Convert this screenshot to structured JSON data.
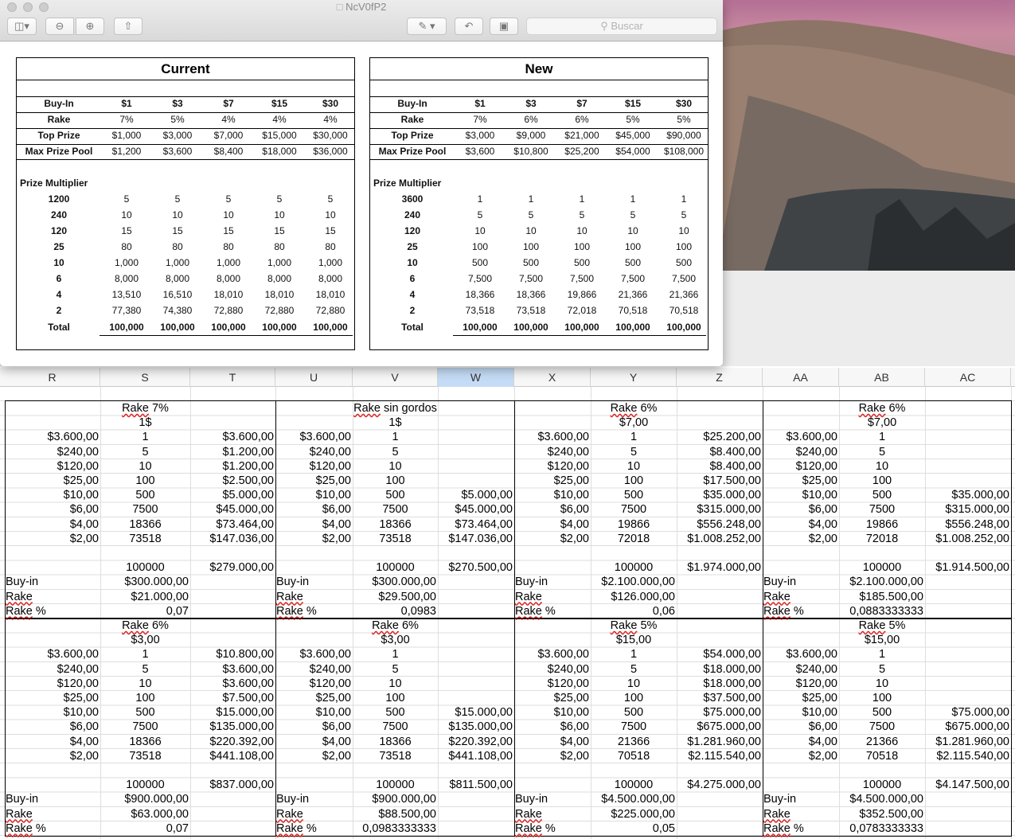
{
  "window": {
    "title": "NcV0fP2",
    "search_placeholder": "Buscar",
    "toolbar_icons": [
      "sidebar-icon",
      "zoom-out-icon",
      "zoom-in-icon",
      "share-icon",
      "markup-pen-icon",
      "rotate-icon",
      "toolbox-icon"
    ]
  },
  "preview": {
    "tables": [
      {
        "title": "Current",
        "columns": [
          "Buy-In",
          "$1",
          "$3",
          "$7",
          "$15",
          "$30"
        ],
        "rows": [
          [
            "Rake",
            "7%",
            "5%",
            "4%",
            "4%",
            "4%"
          ],
          [
            "Top Prize",
            "$1,000",
            "$3,000",
            "$7,000",
            "$15,000",
            "$30,000"
          ],
          [
            "Max Prize Pool",
            "$1,200",
            "$3,600",
            "$8,400",
            "$18,000",
            "$36,000"
          ]
        ],
        "multiplier_label": "Prize Multiplier",
        "multipliers": [
          [
            "1200",
            "5",
            "5",
            "5",
            "5",
            "5"
          ],
          [
            "240",
            "10",
            "10",
            "10",
            "10",
            "10"
          ],
          [
            "120",
            "15",
            "15",
            "15",
            "15",
            "15"
          ],
          [
            "25",
            "80",
            "80",
            "80",
            "80",
            "80"
          ],
          [
            "10",
            "1,000",
            "1,000",
            "1,000",
            "1,000",
            "1,000"
          ],
          [
            "6",
            "8,000",
            "8,000",
            "8,000",
            "8,000",
            "8,000"
          ],
          [
            "4",
            "13,510",
            "16,510",
            "18,010",
            "18,010",
            "18,010"
          ],
          [
            "2",
            "77,380",
            "74,380",
            "72,880",
            "72,880",
            "72,880"
          ]
        ],
        "total": [
          "Total",
          "100,000",
          "100,000",
          "100,000",
          "100,000",
          "100,000"
        ]
      },
      {
        "title": "New",
        "columns": [
          "Buy-In",
          "$1",
          "$3",
          "$7",
          "$15",
          "$30"
        ],
        "rows": [
          [
            "Rake",
            "7%",
            "6%",
            "6%",
            "5%",
            "5%"
          ],
          [
            "Top Prize",
            "$3,000",
            "$9,000",
            "$21,000",
            "$45,000",
            "$90,000"
          ],
          [
            "Max Prize Pool",
            "$3,600",
            "$10,800",
            "$25,200",
            "$54,000",
            "$108,000"
          ]
        ],
        "multiplier_label": "Prize Multiplier",
        "multipliers": [
          [
            "3600",
            "1",
            "1",
            "1",
            "1",
            "1"
          ],
          [
            "240",
            "5",
            "5",
            "5",
            "5",
            "5"
          ],
          [
            "120",
            "10",
            "10",
            "10",
            "10",
            "10"
          ],
          [
            "25",
            "100",
            "100",
            "100",
            "100",
            "100"
          ],
          [
            "10",
            "500",
            "500",
            "500",
            "500",
            "500"
          ],
          [
            "6",
            "7,500",
            "7,500",
            "7,500",
            "7,500",
            "7,500"
          ],
          [
            "4",
            "18,366",
            "18,366",
            "19,866",
            "21,366",
            "21,366"
          ],
          [
            "2",
            "73,518",
            "73,518",
            "72,018",
            "70,518",
            "70,518"
          ]
        ],
        "total": [
          "Total",
          "100,000",
          "100,000",
          "100,000",
          "100,000",
          "100,000"
        ]
      }
    ]
  },
  "sheet": {
    "columns": [
      "R",
      "S",
      "T",
      "U",
      "V",
      "W",
      "X",
      "Y",
      "Z",
      "AA",
      "AB",
      "AC"
    ],
    "selected_column": "W",
    "prize_values": [
      "$3.600,00",
      "$240,00",
      "$120,00",
      "$25,00",
      "$10,00",
      "$6,00",
      "$4,00",
      "$2,00"
    ],
    "label_buyin": "Buy-in",
    "label_rake": "Rake",
    "label_rakepct": "Rake %",
    "blocks": [
      {
        "title": "Rake 7%",
        "buyin": "1$",
        "counts": [
          "1",
          "5",
          "10",
          "100",
          "500",
          "7500",
          "18366",
          "73518"
        ],
        "payouts": [
          "$3.600,00",
          "$1.200,00",
          "$1.200,00",
          "$2.500,00",
          "$5.000,00",
          "$45.000,00",
          "$73.464,00",
          "$147.036,00"
        ],
        "total_count": "100000",
        "total_payout": "$279.000,00",
        "buyin_total": "$300.000,00",
        "rake": "$21.000,00",
        "rake_pct": "0,07"
      },
      {
        "title": "Rake sin gordos",
        "buyin": "1$",
        "counts": [
          "1",
          "5",
          "10",
          "100",
          "500",
          "7500",
          "18366",
          "73518"
        ],
        "payouts": [
          "",
          "",
          "",
          "",
          "$5.000,00",
          "$45.000,00",
          "$73.464,00",
          "$147.036,00"
        ],
        "total_count": "100000",
        "total_payout": "$270.500,00",
        "buyin_total": "$300.000,00",
        "rake": "$29.500,00",
        "rake_pct": "0,0983"
      },
      {
        "title": "Rake 6%",
        "buyin": "$7,00",
        "counts": [
          "1",
          "5",
          "10",
          "100",
          "500",
          "7500",
          "19866",
          "72018"
        ],
        "payouts": [
          "$25.200,00",
          "$8.400,00",
          "$8.400,00",
          "$17.500,00",
          "$35.000,00",
          "$315.000,00",
          "$556.248,00",
          "$1.008.252,00"
        ],
        "total_count": "100000",
        "total_payout": "$1.974.000,00",
        "buyin_total": "$2.100.000,00",
        "rake": "$126.000,00",
        "rake_pct": "0,06"
      },
      {
        "title": "Rake 6%",
        "buyin": "$7,00",
        "counts": [
          "1",
          "5",
          "10",
          "100",
          "500",
          "7500",
          "19866",
          "72018"
        ],
        "payouts": [
          "",
          "",
          "",
          "",
          "$35.000,00",
          "$315.000,00",
          "$556.248,00",
          "$1.008.252,00"
        ],
        "total_count": "100000",
        "total_payout": "$1.914.500,00",
        "buyin_total": "$2.100.000,00",
        "rake": "$185.500,00",
        "rake_pct": "0,0883333333"
      },
      {
        "title": "Rake 6%",
        "buyin": "$3,00",
        "counts": [
          "1",
          "5",
          "10",
          "100",
          "500",
          "7500",
          "18366",
          "73518"
        ],
        "payouts": [
          "$10.800,00",
          "$3.600,00",
          "$3.600,00",
          "$7.500,00",
          "$15.000,00",
          "$135.000,00",
          "$220.392,00",
          "$441.108,00"
        ],
        "total_count": "100000",
        "total_payout": "$837.000,00",
        "buyin_total": "$900.000,00",
        "rake": "$63.000,00",
        "rake_pct": "0,07"
      },
      {
        "title": "Rake 6%",
        "buyin": "$3,00",
        "counts": [
          "1",
          "5",
          "10",
          "100",
          "500",
          "7500",
          "18366",
          "73518"
        ],
        "payouts": [
          "",
          "",
          "",
          "",
          "$15.000,00",
          "$135.000,00",
          "$220.392,00",
          "$441.108,00"
        ],
        "total_count": "100000",
        "total_payout": "$811.500,00",
        "buyin_total": "$900.000,00",
        "rake": "$88.500,00",
        "rake_pct": "0,0983333333"
      },
      {
        "title": "Rake 5%",
        "buyin": "$15,00",
        "counts": [
          "1",
          "5",
          "10",
          "100",
          "500",
          "7500",
          "21366",
          "70518"
        ],
        "payouts": [
          "$54.000,00",
          "$18.000,00",
          "$18.000,00",
          "$37.500,00",
          "$75.000,00",
          "$675.000,00",
          "$1.281.960,00",
          "$2.115.540,00"
        ],
        "total_count": "100000",
        "total_payout": "$4.275.000,00",
        "buyin_total": "$4.500.000,00",
        "rake": "$225.000,00",
        "rake_pct": "0,05"
      },
      {
        "title": "Rake 5%",
        "buyin": "$15,00",
        "counts": [
          "1",
          "5",
          "10",
          "100",
          "500",
          "7500",
          "21366",
          "70518"
        ],
        "payouts": [
          "",
          "",
          "",
          "",
          "$75.000,00",
          "$675.000,00",
          "$1.281.960,00",
          "$2.115.540,00"
        ],
        "total_count": "100000",
        "total_payout": "$4.147.500,00",
        "buyin_total": "$4.500.000,00",
        "rake": "$352.500,00",
        "rake_pct": "0,0783333333"
      }
    ]
  }
}
